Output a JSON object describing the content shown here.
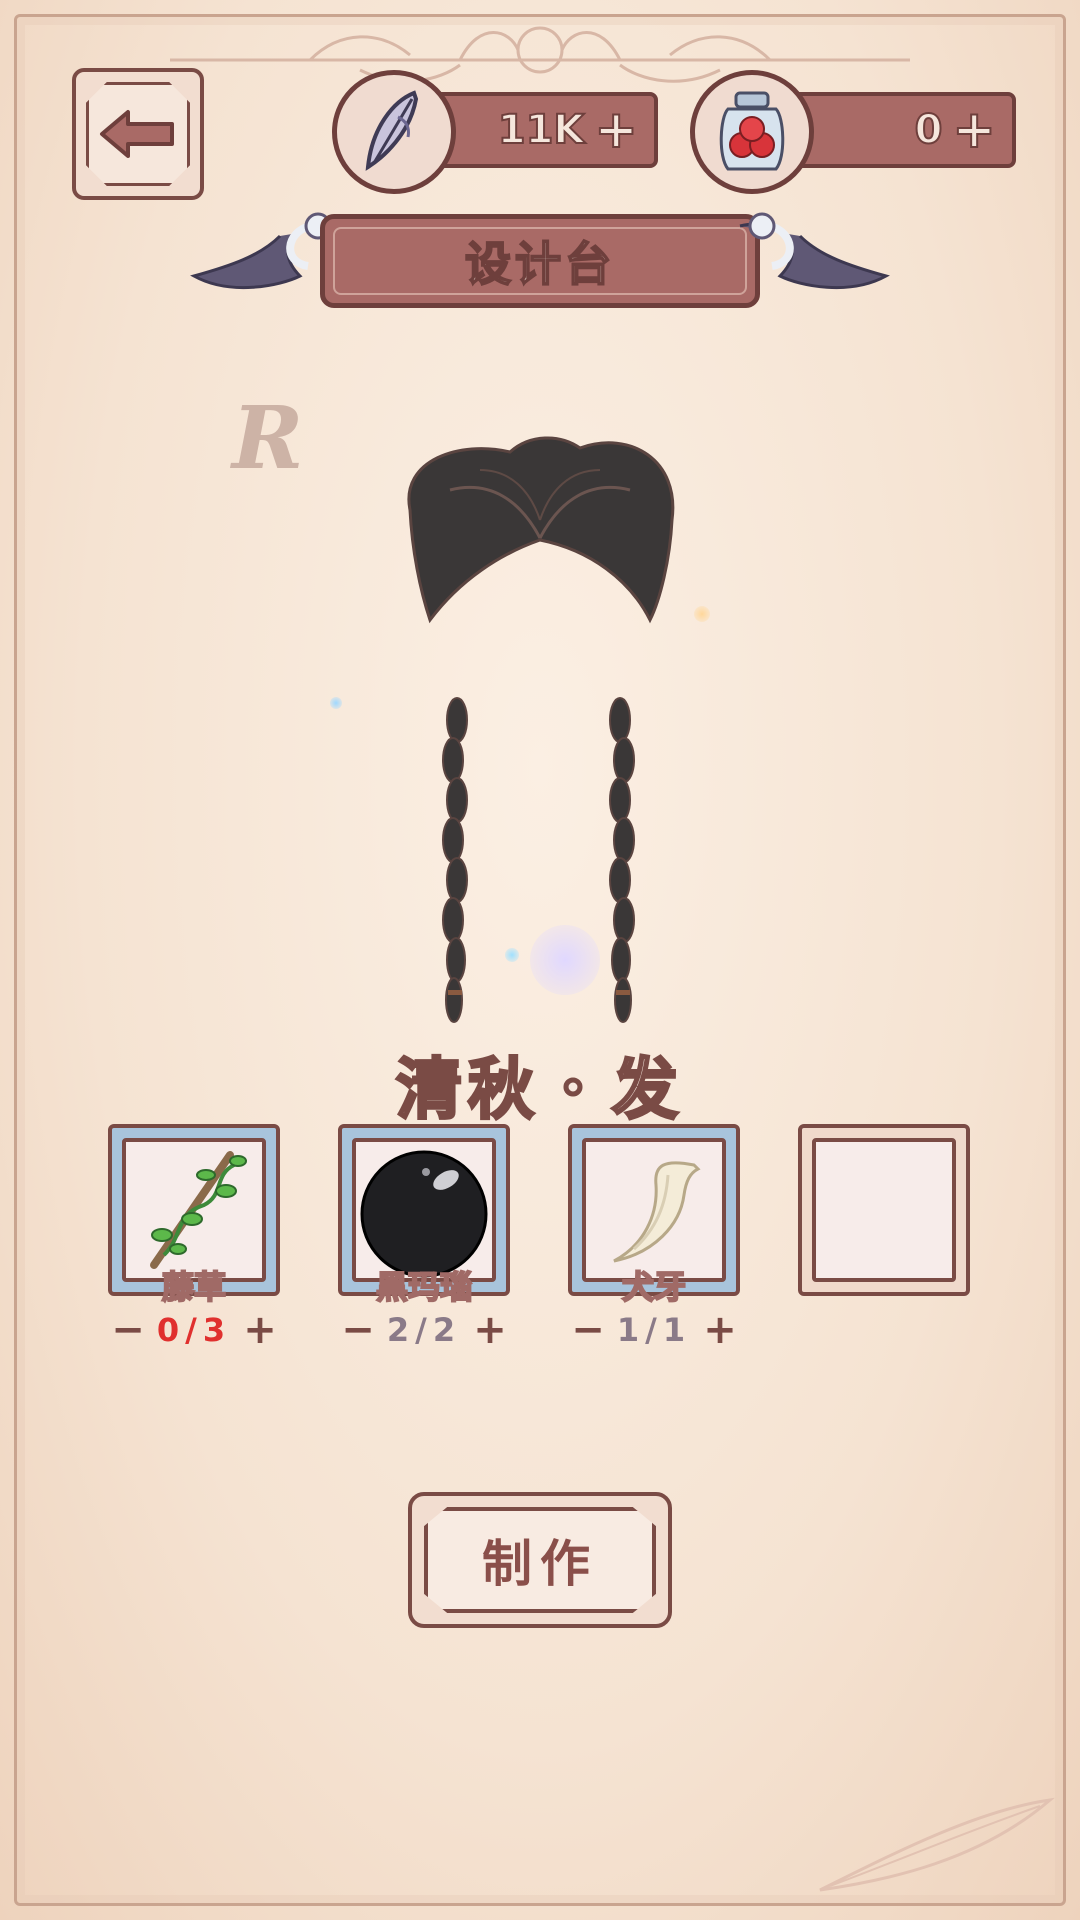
{
  "header": {
    "back_icon": "back-arrow-icon",
    "currencies": [
      {
        "icon": "feather-quill-icon",
        "value": "11K",
        "plus": "+"
      },
      {
        "icon": "berry-jar-icon",
        "value": "0",
        "plus": "+"
      }
    ],
    "title": "设计台"
  },
  "preview": {
    "rarity": "R",
    "item_name": "清秋・发",
    "art": "braided-hair"
  },
  "materials": [
    {
      "name": "藤草",
      "icon": "vine-branch-icon",
      "have": "0",
      "need": "3",
      "count_text": "0/3",
      "insufficient": true
    },
    {
      "name": "黑玛瑙",
      "icon": "black-agate-icon",
      "have": "2",
      "need": "2",
      "count_text": "2/2",
      "insufficient": false
    },
    {
      "name": "犬牙",
      "icon": "fang-icon",
      "have": "1",
      "need": "1",
      "count_text": "1/1",
      "insufficient": false
    },
    {
      "name": "",
      "icon": "",
      "empty": true
    }
  ],
  "counter_buttons": {
    "minus": "−",
    "plus": "+"
  },
  "craft_button": {
    "label": "制作"
  },
  "colors": {
    "accent": "#a96a66",
    "outline": "#6e3f3c",
    "background": "#f6e6d6",
    "insufficient": "#e0302e"
  }
}
